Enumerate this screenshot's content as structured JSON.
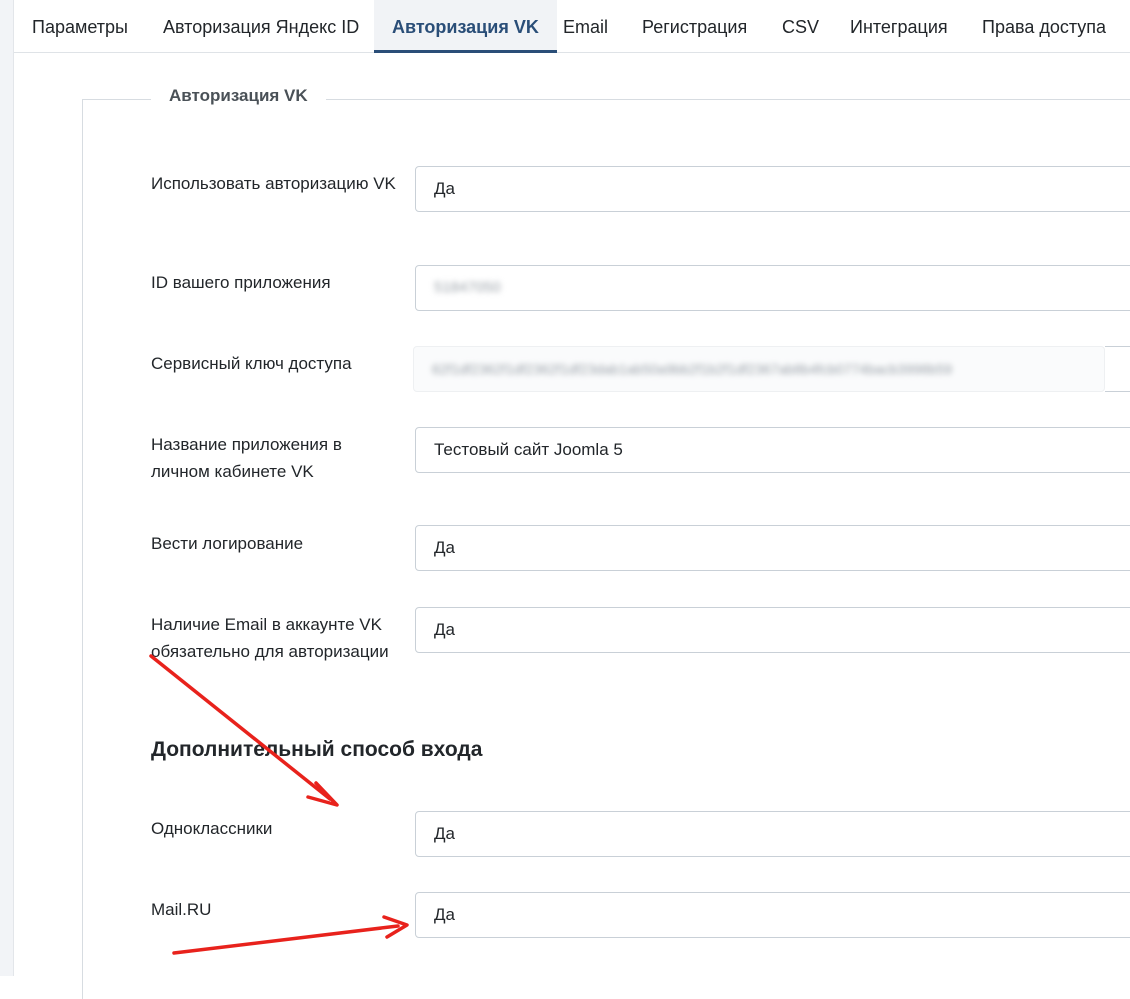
{
  "tabs": [
    {
      "label": "Параметры"
    },
    {
      "label": "Авторизация Яндекс ID"
    },
    {
      "label": "Авторизация VK"
    },
    {
      "label": "Email"
    },
    {
      "label": "Регистрация"
    },
    {
      "label": "CSV"
    },
    {
      "label": "Интеграция"
    },
    {
      "label": "Права доступа"
    }
  ],
  "active_tab": "Авторизация VK",
  "fieldset": {
    "legend": "Авторизация VK"
  },
  "fields": {
    "use_vk_auth": {
      "label": "Использовать авторизацию VK",
      "value": "Да"
    },
    "app_id": {
      "label": "ID вашего приложения",
      "value": "51847050"
    },
    "service_key": {
      "label": "Сервисный ключ доступа",
      "value": "62f1df2362f1df2362f1df23dab1ab50a9bb2f1b2f1df2367ab8b4fcb0774bacb3998b59"
    },
    "app_name": {
      "label": "Название приложения в личном кабинете VK",
      "value": "Тестовый сайт Joomla 5"
    },
    "logging": {
      "label": "Вести логирование",
      "value": "Да"
    },
    "email_required": {
      "label": "Наличие Email в аккаунте VK обязательно для авторизации",
      "value": "Да"
    }
  },
  "additional": {
    "title": "Дополнительный способ входа",
    "odnoklassniki": {
      "label": "Одноклассники",
      "value": "Да"
    },
    "mailru": {
      "label": "Mail.RU",
      "value": "Да"
    }
  },
  "colors": {
    "accent": "#2a4e78",
    "annotation_arrow": "#e8221c"
  }
}
